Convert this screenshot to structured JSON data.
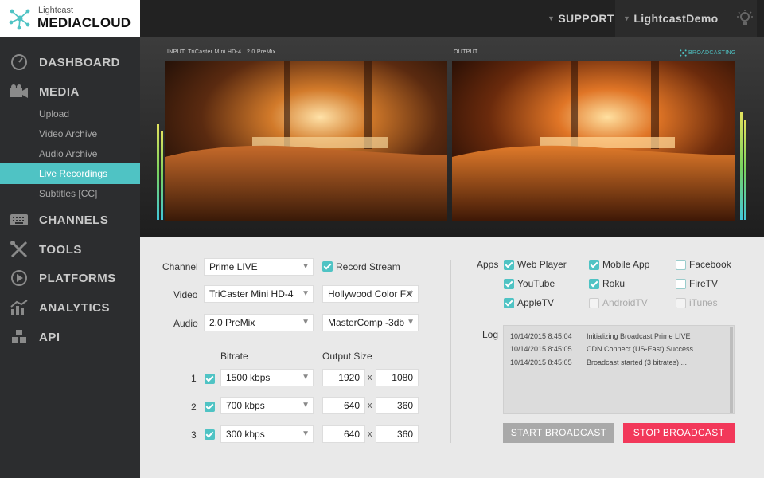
{
  "brand": {
    "small": "Lightcast",
    "big": "MEDIACLOUD"
  },
  "topbar": {
    "support": "SUPPORT",
    "user": "LightcastDemo"
  },
  "nav": {
    "dashboard": "DASHBOARD",
    "media": "MEDIA",
    "media_items": [
      "Upload",
      "Video Archive",
      "Audio Archive",
      "Live Recordings",
      "Subtitles [CC]"
    ],
    "channels": "CHANNELS",
    "tools": "TOOLS",
    "platforms": "PLATFORMS",
    "analytics": "ANALYTICS",
    "api": "API"
  },
  "preview": {
    "input_label": "INPUT: TriCaster Mini HD-4 | 2.0 PreMix",
    "output_label": "OUTPUT",
    "status": "BROADCASTING"
  },
  "form": {
    "channel_label": "Channel",
    "channel_value": "Prime LIVE",
    "record_label": "Record Stream",
    "video_label": "Video",
    "video_value": "TriCaster Mini HD-4",
    "video_fx": "Hollywood Color FX",
    "audio_label": "Audio",
    "audio_value": "2.0 PreMix",
    "audio_fx": "MasterComp -3db",
    "bitrate_header": "Bitrate",
    "size_header": "Output Size",
    "rows": [
      {
        "num": "1",
        "bitrate": "1500 kbps",
        "w": "1920",
        "h": "1080"
      },
      {
        "num": "2",
        "bitrate": "700 kbps",
        "w": "640",
        "h": "360"
      },
      {
        "num": "3",
        "bitrate": "300 kbps",
        "w": "640",
        "h": "360"
      }
    ],
    "x": "x"
  },
  "apps": {
    "label": "Apps",
    "items": [
      "Web Player",
      "Mobile App",
      "Facebook",
      "YouTube",
      "Roku",
      "FireTV",
      "AppleTV",
      "AndroidTV",
      "iTunes"
    ]
  },
  "log": {
    "label": "Log",
    "lines": [
      {
        "time": "10/14/2015 8:45:04",
        "msg": "Initializing Broadcast Prime LIVE"
      },
      {
        "time": "10/14/2015 8:45:05",
        "msg": "CDN Connect (US-East) Success"
      },
      {
        "time": "10/14/2015 8:45:05",
        "msg": "Broadcast started (3 bitrates) ..."
      }
    ]
  },
  "buttons": {
    "start": "START BROADCAST",
    "stop": "STOP BROADCAST"
  },
  "colors": {
    "accent": "#4fc3c4",
    "stop": "#f2385a",
    "start": "#a9a9a9",
    "sidebar": "#2c2d2f"
  }
}
